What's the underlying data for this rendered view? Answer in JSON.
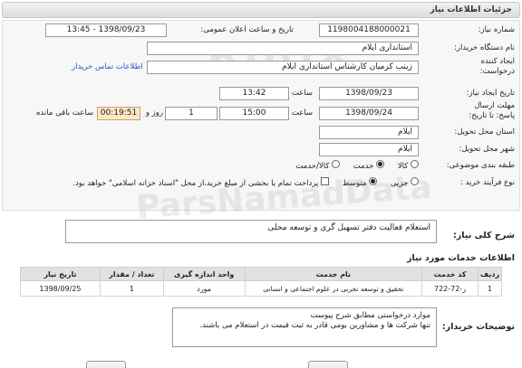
{
  "header": {
    "title": "جزئیات اطلاعات نیاز"
  },
  "form": {
    "need_number_label": "شماره نیاز:",
    "need_number": "1198004188000021",
    "announce_label": "تاریخ و ساعت اعلان عمومی:",
    "announce_value": "1398/09/23 - 13:45",
    "buyer_org_label": "نام دستگاه خریدار:",
    "buyer_org": "استانداری ایلام",
    "creator_label": "ایجاد کننده درخواست:",
    "creator": "زینب کرمیان کارشناس استانداری ایلام",
    "contact_link": "اطلاعات تماس خریدار",
    "created_date_label": "تاریخ ایجاد نیاز:",
    "created_date": "1398/09/23",
    "time_label": "ساعت",
    "created_time": "13:42",
    "deadline_label": "مهلت ارسال پاسخ: تا تاریخ:",
    "deadline_date": "1398/09/24",
    "deadline_time": "15:00",
    "days_label": "روز و",
    "days": "1",
    "remaining_time": "00:19:51",
    "remaining_label": "ساعت باقی مانده",
    "province_label": "استان محل تحویل:",
    "province": "ایلام",
    "city_label": "شهر محل تحویل:",
    "city": "ایلام",
    "category_label": "طبقه بندی موضوعی:",
    "category_options": [
      "کالا",
      "خدمت",
      "کالا/خدمت"
    ],
    "category_selected": "خدمت",
    "process_label": "نوع فرآیند خرید :",
    "process_options": [
      "جزیی",
      "متوسط"
    ],
    "process_selected": "متوسط",
    "payment_note": "پرداخت تمام یا بخشی از مبلغ خرید،از محل \"اسناد خزانه اسلامی\" خواهد بود."
  },
  "summary": {
    "label": "شرح کلی نیاز:",
    "value": "استعلام فعالیت دفتر تسهیل گری و توسعه محلی"
  },
  "services": {
    "title": "اطلاعات خدمات مورد نیاز",
    "headers": [
      "ردیف",
      "کد خدمت",
      "نام خدمت",
      "واحد اندازه گیری",
      "تعداد / مقدار",
      "تاریخ نیاز"
    ],
    "rows": [
      [
        "1",
        "ز-72-722",
        "تحقیق و توسعه تجربی در علوم اجتماعی و انسانی",
        "مورد",
        "1",
        "1398/09/25"
      ]
    ]
  },
  "buyer_notes": {
    "label": "توضیحات خریدار:",
    "line1": "موارد درخواستی مطابق شرح پیوست",
    "line2": "تنها شرکت ها و مشاورین بومی قادر به ثبت قیمت در استعلام می باشند."
  }
}
